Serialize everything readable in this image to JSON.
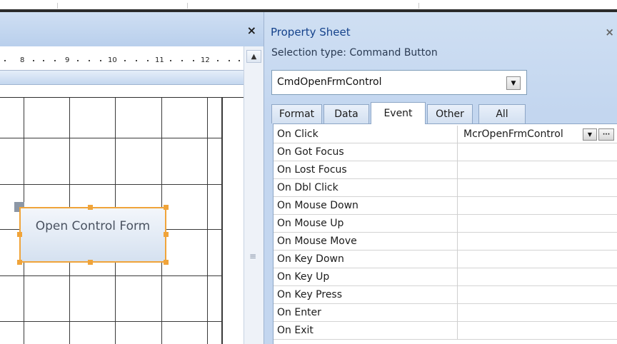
{
  "design": {
    "close_glyph": "×",
    "ruler_labels": [
      "8",
      "9",
      "10",
      "11",
      "12"
    ],
    "scroll_up_glyph": "▲",
    "scroll_grip_glyph": "≡",
    "button_label": "Open Control Form"
  },
  "property_sheet": {
    "title": "Property Sheet",
    "close_glyph": "×",
    "selection_type": "Selection type:  Command Button",
    "object_name": "CmdOpenFrmControl",
    "combo_arrow": "▼",
    "tabs": [
      {
        "label": "Format"
      },
      {
        "label": "Data"
      },
      {
        "label": "Event"
      },
      {
        "label": "Other"
      },
      {
        "label": "All"
      }
    ],
    "active_tab": "Event",
    "events": [
      {
        "name": "On Click",
        "value": "McrOpenFrmControl"
      },
      {
        "name": "On Got Focus",
        "value": ""
      },
      {
        "name": "On Lost Focus",
        "value": ""
      },
      {
        "name": "On Dbl Click",
        "value": ""
      },
      {
        "name": "On Mouse Down",
        "value": ""
      },
      {
        "name": "On Mouse Up",
        "value": ""
      },
      {
        "name": "On Mouse Move",
        "value": ""
      },
      {
        "name": "On Key Down",
        "value": ""
      },
      {
        "name": "On Key Up",
        "value": ""
      },
      {
        "name": "On Key Press",
        "value": ""
      },
      {
        "name": "On Enter",
        "value": ""
      },
      {
        "name": "On Exit",
        "value": ""
      }
    ],
    "value_drop_glyph": "▼",
    "builder_glyph": "···"
  },
  "colors": {
    "accent_orange": "#f0a43a",
    "header_blue": "#cfdff3",
    "title_blue": "#15428b"
  }
}
